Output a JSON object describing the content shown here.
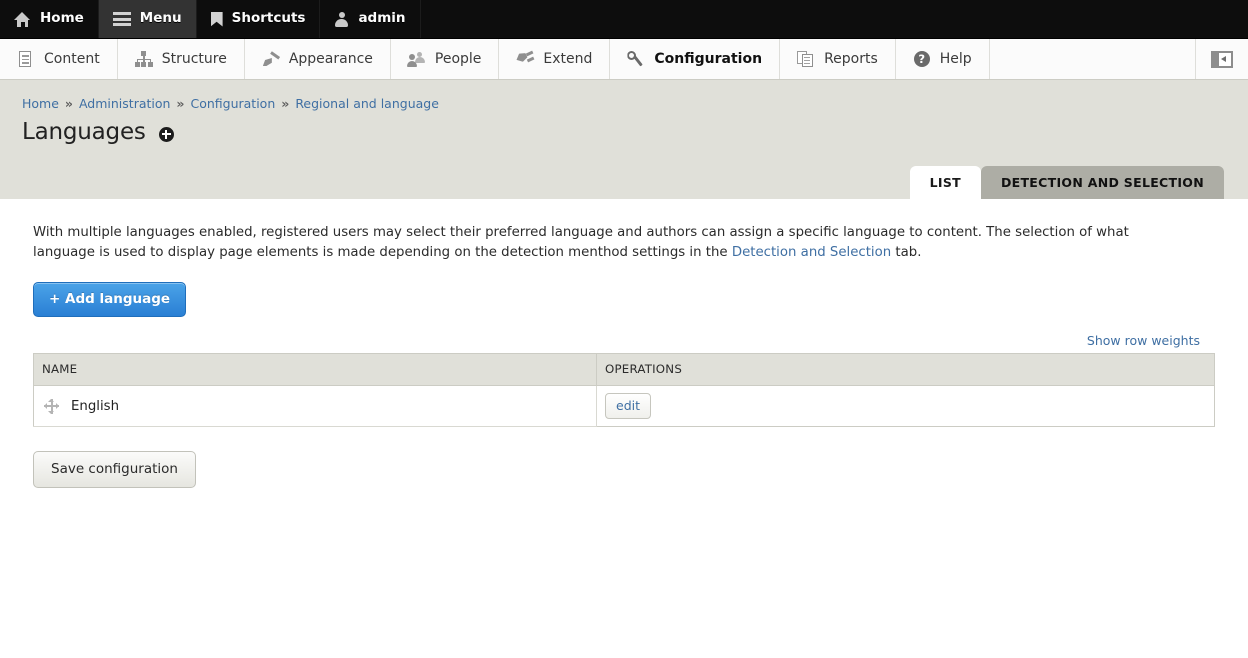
{
  "toolbar": {
    "items": [
      {
        "label": "Home",
        "icon": "home-icon",
        "active": false
      },
      {
        "label": "Menu",
        "icon": "hamburger-icon",
        "active": true
      },
      {
        "label": "Shortcuts",
        "icon": "bookmark-icon",
        "active": false
      },
      {
        "label": "admin",
        "icon": "person-icon",
        "active": false
      }
    ]
  },
  "admin_menu": {
    "items": [
      {
        "label": "Content",
        "icon": "document-icon",
        "active": false
      },
      {
        "label": "Structure",
        "icon": "sitemap-icon",
        "active": false
      },
      {
        "label": "Appearance",
        "icon": "paintbrush-icon",
        "active": false
      },
      {
        "label": "People",
        "icon": "people-icon",
        "active": false
      },
      {
        "label": "Extend",
        "icon": "plug-icon",
        "active": false
      },
      {
        "label": "Configuration",
        "icon": "wrench-icon",
        "active": true
      },
      {
        "label": "Reports",
        "icon": "reports-icon",
        "active": false
      },
      {
        "label": "Help",
        "icon": "question-circle-icon",
        "active": false
      }
    ],
    "tray_toggle_icon": "toolbar-orientation-toggle-icon"
  },
  "breadcrumb": {
    "items": [
      "Home",
      "Administration",
      "Configuration",
      "Regional and language"
    ],
    "separator": "»"
  },
  "page": {
    "title": "Languages",
    "contextual_icon": "plus-circle-icon"
  },
  "tabs": [
    {
      "label": "LIST",
      "active": true
    },
    {
      "label": "DETECTION AND SELECTION",
      "active": false
    }
  ],
  "intro": {
    "text_part1": "With multiple languages enabled, registered users may select their preferred language and authors can assign a specific language to content. The selection of what language is used to display page elements is made depending on the detection menthod settings in the ",
    "link_text": "Detection and Selection",
    "text_part2": " tab."
  },
  "actions": {
    "add_language_label": "+ Add language",
    "show_row_weights_label": "Show row weights",
    "save_label": "Save configuration"
  },
  "table": {
    "columns": [
      "NAME",
      "OPERATIONS"
    ],
    "rows": [
      {
        "name": "English",
        "operation_label": "edit",
        "drag_icon": "drag-handle-icon"
      }
    ]
  },
  "colors": {
    "toolbar_bg": "#0d0d0d",
    "header_band": "#e0e0d9",
    "link": "#3f6fa3",
    "primary_button": "#2a7fd4",
    "inactive_tab": "#adada5"
  }
}
